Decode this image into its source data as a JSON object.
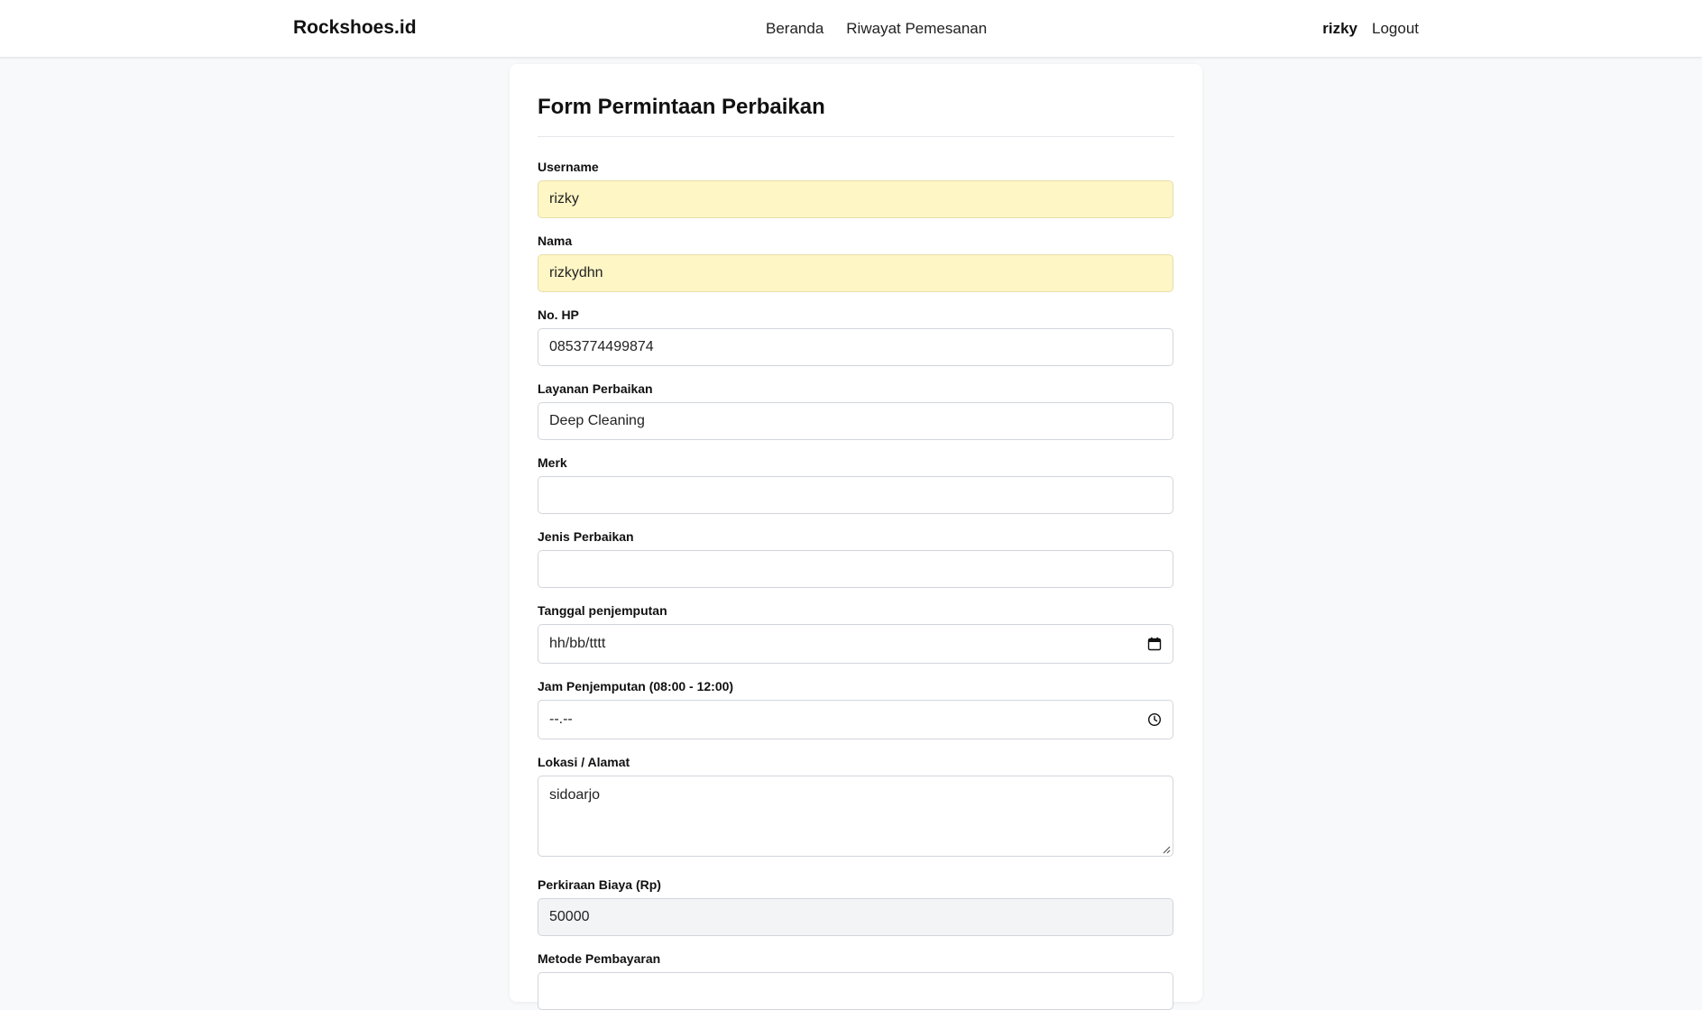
{
  "nav": {
    "brand": "Rockshoes.id",
    "links": [
      "Beranda",
      "Riwayat Pemesanan"
    ],
    "user": "rizky",
    "logout": "Logout"
  },
  "form": {
    "title": "Form Permintaan Perbaikan",
    "username": {
      "label": "Username",
      "value": "rizky"
    },
    "nama": {
      "label": "Nama",
      "value": "rizkydhn"
    },
    "no_hp": {
      "label": "No. HP",
      "value": "0853774499874"
    },
    "layanan": {
      "label": "Layanan Perbaikan",
      "value": "Deep Cleaning"
    },
    "merk": {
      "label": "Merk",
      "value": ""
    },
    "jenis": {
      "label": "Jenis Perbaikan",
      "value": ""
    },
    "tanggal": {
      "label": "Tanggal penjemputan",
      "placeholder": "hh/bb/tttt",
      "icon": "calendar-icon"
    },
    "jam": {
      "label": "Jam Penjemputan (08:00 - 12:00)",
      "placeholder": "--.--",
      "icon": "clock-icon"
    },
    "lokasi": {
      "label": "Lokasi / Alamat",
      "value": "sidoarjo"
    },
    "biaya": {
      "label": "Perkiraan Biaya (Rp)",
      "value": "50000"
    },
    "metode": {
      "label": "Metode Pembayaran"
    }
  },
  "colors": {
    "autofill_bg": "#fef6c5",
    "readonly_bg": "#f3f4f6",
    "page_bg": "#f8f9fa"
  }
}
